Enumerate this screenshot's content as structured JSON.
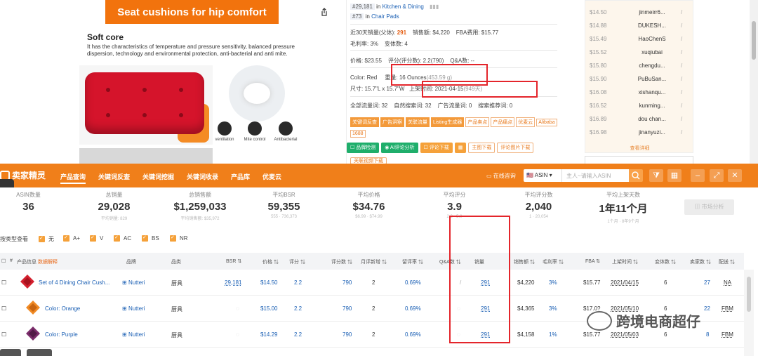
{
  "product": {
    "banner": "Seat cushions for hip comfort",
    "soft_title": "Soft core",
    "soft_desc": "It has the characteristics of temperature and pressure sensitivity, balanced pressure dispersion, technology and environmental protection, anti-bacterial and anti mite.",
    "features": [
      "ventilation",
      "Mite control",
      "Antibacterial"
    ]
  },
  "info": {
    "rank1_num": "#29,181",
    "rank1_in": "in",
    "rank1_cat": "Kitchen & Dining",
    "rank2_num": "#73",
    "rank2_in": "in",
    "rank2_cat": "Chair Pads",
    "sales30_label": "近30天销量(父体):",
    "sales30": "291",
    "revenue_label": "销售额:",
    "revenue": "$4,220",
    "fba_label": "FBA费用:",
    "fba": "$15.77",
    "margin_label": "毛利率:",
    "margin": "3%",
    "variants_label": "变体数:",
    "variants": "4",
    "price_label": "价格:",
    "price": "$23.55",
    "rating_label": "评分(评分数):",
    "rating": "2.2(790)",
    "qa_label": "Q&A数:",
    "qa": "--",
    "color_label": "Color:",
    "color": "Red",
    "weight_label": "重量:",
    "weight": "16 Ounces",
    "weight_g": "(453.59 g)",
    "size_label": "尺寸:",
    "size": "15.7\"L x 15.7\"W",
    "launch_label": "上架时间:",
    "launch": "2021-04-15",
    "launch_days": "(949天)",
    "traffic": "全部流量词: 32",
    "natural": "自然搜索词: 32",
    "ads": "广告流量词: 0",
    "rec": "搜索推荐词: 0",
    "tags_fill": [
      "关键词反查",
      "广告洞察",
      "关联流量",
      "Listing生成器"
    ],
    "tags_outline": [
      "产品卖点",
      "产品痛点",
      "优麦云",
      "Alibaba",
      "1688"
    ],
    "btn_keyword": "品牌检测",
    "btn_ai": "AI评论分析",
    "btn_review_dl": "评论下载",
    "btn_img_dl": "主图下载",
    "btn_review_img": "评论图片下载",
    "btn_related": "关联视频下载"
  },
  "history": {
    "rows": [
      {
        "price": "$14.50",
        "seller": "jinmeirr6..."
      },
      {
        "price": "$14.88",
        "seller": "DUKESH..."
      },
      {
        "price": "$15.49",
        "seller": "HaoChenS"
      },
      {
        "price": "$15.52",
        "seller": "xuqiubai"
      },
      {
        "price": "$15.80",
        "seller": "chengdu..."
      },
      {
        "price": "$15.90",
        "seller": "PuBuSan..."
      },
      {
        "price": "$16.08",
        "seller": "xishanqu..."
      },
      {
        "price": "$16.52",
        "seller": "kunming..."
      },
      {
        "price": "$16.89",
        "seller": "dou chan..."
      },
      {
        "price": "$16.98",
        "seller": "jinanyuzi..."
      }
    ],
    "slash": "/",
    "more": "查看详细"
  },
  "plugin": {
    "logo": "卖家精灵",
    "nav": [
      "产品查询",
      "关键词反查",
      "关键词挖掘",
      "关键词收录",
      "产品库",
      "优麦云"
    ],
    "consult": "在线咨询",
    "asin": "ASIN",
    "placeholder": "主人~请输入ASIN"
  },
  "stats": [
    {
      "label": "ASIN数量",
      "value": "36",
      "sub": ""
    },
    {
      "label": "总销量",
      "value": "29,028",
      "sub": "平均销量: 829"
    },
    {
      "label": "总销售额",
      "value": "$1,259,033",
      "sub": "平均销售额: $35,972"
    },
    {
      "label": "平均BSR",
      "value": "59,355",
      "sub": "555 · 736,373"
    },
    {
      "label": "平均价格",
      "value": "$34.76",
      "sub": "$6.99 · $74.99"
    },
    {
      "label": "平均评分",
      "value": "3.9",
      "sub": "2.2 · 5.0"
    },
    {
      "label": "平均评分数",
      "value": "2,040",
      "sub": "1 · 20,054"
    },
    {
      "label": "平均上架天数",
      "value": "1年11个月",
      "sub": "1个月 · 8年9个月"
    }
  ],
  "market_btn": "市场分析",
  "filters": {
    "label": "按类型查看",
    "items": [
      "无",
      "A+",
      "V",
      "AC",
      "BS",
      "NR"
    ]
  },
  "table": {
    "headers": {
      "info": "产品信息",
      "info_link": "数据解释",
      "brand": "品牌",
      "category": "品类",
      "bsr": "BSR",
      "price": "价格",
      "rating": "评分",
      "reviews": "评分数",
      "monthly_new": "月评新增",
      "review_rate": "留评率",
      "qa": "Q&A数",
      "sales": "销量",
      "revenue": "销售额",
      "margin": "毛利率",
      "fba": "FBA",
      "launch": "上架时间",
      "variants": "变体数",
      "sellers": "卖家数",
      "ship": "配送"
    },
    "rows": [
      {
        "name": "Set of 4 Dining Chair Cush...",
        "brand": "Nutteri",
        "category": "厨具",
        "bsr": "29,181",
        "price": "$14.50",
        "rating": "2.2",
        "reviews": "790",
        "monthly_new": "2",
        "review_rate": "0.69%",
        "qa": "/",
        "sales": "291",
        "revenue": "$4,220",
        "margin": "3%",
        "fba": "$15.77",
        "launch": "2021/04/15",
        "variants": "6",
        "sellers": "27",
        "ship": "NA",
        "color": "#d4212f"
      },
      {
        "name": "Color: Orange",
        "brand": "Nutteri",
        "category": "厨具",
        "bsr": "",
        "price": "$15.00",
        "rating": "2.2",
        "reviews": "790",
        "monthly_new": "2",
        "review_rate": "0.69%",
        "qa": "",
        "sales": "291",
        "revenue": "$4,365",
        "margin": "3%",
        "fba": "$17.0?",
        "launch": "2021/05/10",
        "variants": "6",
        "sellers": "22",
        "ship": "FBM",
        "color": "#f08a24"
      },
      {
        "name": "Color: Purple",
        "brand": "Nutteri",
        "category": "厨具",
        "bsr": "",
        "price": "$14.29",
        "rating": "2.2",
        "reviews": "790",
        "monthly_new": "2",
        "review_rate": "0.69%",
        "qa": "",
        "sales": "291",
        "revenue": "$4,158",
        "margin": "1%",
        "fba": "$15.77",
        "launch": "2021/05/03",
        "variants": "6",
        "sellers": "8",
        "ship": "FBM",
        "color": "#7a2c6a"
      }
    ]
  },
  "watermark": "跨境电商超仔"
}
